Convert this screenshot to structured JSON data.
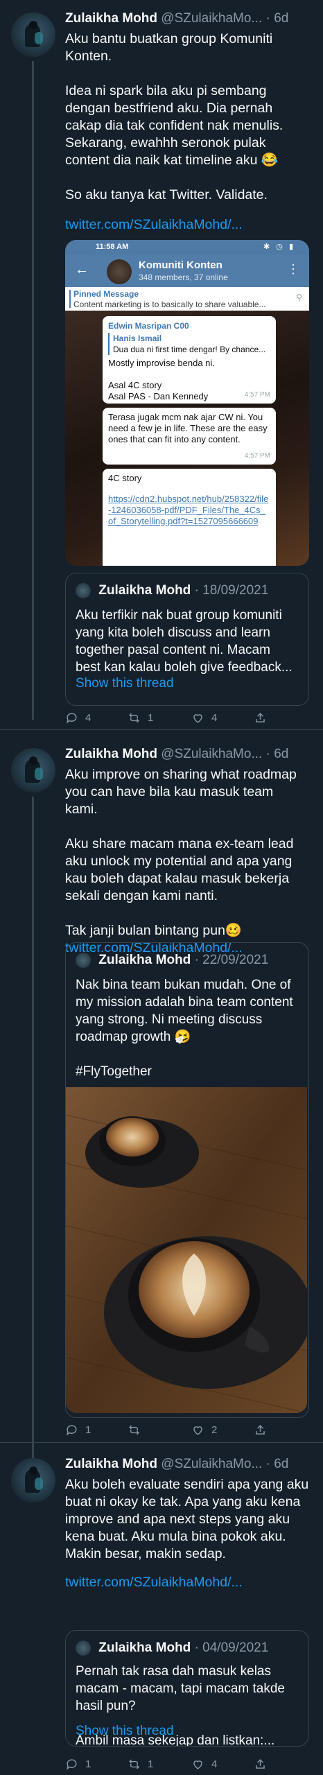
{
  "tweets": [
    {
      "name": "Zulaikha Mohd",
      "handle": "@SZulaikhaMo...",
      "dot": "·",
      "time": "6d",
      "text": "Aku bantu buatkan group Komuniti Konten.\n\nIdea ni spark bila aku pi sembang dengan bestfriend aku. Dia pernah cakap dia tak confident nak menulis. Sekarang, ewahhh seronok pulak content dia naik kat timeline aku 😂\n\nSo aku tanya kat Twitter. Validate.",
      "link": "twitter.com/SZulaikhaMohd/...",
      "screenshot": {
        "status_time": "11:58 AM",
        "group_name": "Komuniti Konten",
        "group_meta": "348 members, 37 online",
        "pinned_label": "Pinned Message",
        "pinned_text": "Content marketing is to basically to share valuable...",
        "bubble1_sender": "Edwin Masripan C00",
        "bubble1_reply_name": "Hanis Ismail",
        "bubble1_reply_text": "Dua dua ni first time dengar! By chance...",
        "bubble1_text": "Mostly improvise benda ni.\n\nAsal 4C story\nAsal PAS - Dan Kennedy",
        "bubble1_time": "4:57 PM",
        "bubble2_text": "Terasa jugak mcm nak ajar CW ni. You need a few je in life. These are the easy ones that can fit into any content.",
        "bubble2_time": "4:57 PM",
        "bubble3_title": "4C story",
        "bubble3_link": "https://cdn2.hubspot.net/hub/258322/file-1246036058-pdf/PDF_Files/The_4Cs_of_Storytelling.pdf?t=1527095666609"
      },
      "quote": {
        "name": "Zulaikha Mohd",
        "dot": "·",
        "date": "18/09/2021",
        "text": "Aku terfikir nak buat group komuniti yang kita boleh discuss and learn together pasal content ni. Macam best kan kalau boleh give feedback...",
        "show_thread": "Show this thread"
      },
      "replies": "4",
      "retweets": "1",
      "likes": "4"
    },
    {
      "name": "Zulaikha Mohd",
      "handle": "@SZulaikhaMo...",
      "dot": "·",
      "time": "6d",
      "text": "Aku improve on sharing what roadmap you can have bila kau masuk team kami.\n\nAku share macam mana ex-team lead aku unlock my potential and apa yang kau boleh dapat kalau masuk bekerja sekali dengan kami nanti.\n\nTak janji bulan bintang pun🥴",
      "link": "twitter.com/SZulaikhaMohd/...",
      "quote": {
        "name": "Zulaikha Mohd",
        "dot": "·",
        "date": "22/09/2021",
        "text": "Nak bina team bukan mudah. One of my mission adalah bina team content yang strong. Ni meeting discuss roadmap growth 🤧\n\n#FlyTogether"
      },
      "replies": "1",
      "retweets": "",
      "likes": "2"
    },
    {
      "name": "Zulaikha Mohd",
      "handle": "@SZulaikhaMo...",
      "dot": "·",
      "time": "6d",
      "text": "Aku boleh evaluate sendiri apa yang aku buat ni okay ke tak. Apa yang aku kena improve and apa next steps yang aku kena buat. Aku mula bina pokok aku. Makin besar, makin sedap.",
      "link": "twitter.com/SZulaikhaMohd/...",
      "quote": {
        "name": "Zulaikha Mohd",
        "dot": "·",
        "date": "04/09/2021",
        "text": "Pernah tak rasa dah masuk kelas macam - macam, tapi macam takde hasil pun?\n\nAmbil masa sekejap dan listkan:...",
        "show_thread": "Show this thread"
      },
      "replies": "1",
      "retweets": "1",
      "likes": "4"
    }
  ],
  "colors": {
    "background": "#15202b",
    "text": "#f7f9f9",
    "secondary": "#8b98a5",
    "link": "#1d9bf0",
    "border": "#38444d"
  }
}
